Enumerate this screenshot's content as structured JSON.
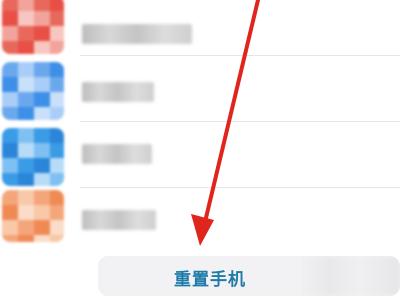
{
  "colors": {
    "accent_text": "#1e7aa8",
    "arrow": "#e0261c",
    "button_bg": "#f2f2f4",
    "separator": "#e6e6e6"
  },
  "list": {
    "items": [
      {
        "icon": "app-icon-red",
        "label": "",
        "icon_colors": [
          "#e8685c",
          "#f2a49c",
          "#e84f45",
          "#f7c6c0"
        ]
      },
      {
        "icon": "app-icon-blue",
        "label": "",
        "icon_colors": [
          "#6aa8ee",
          "#a9cdf6",
          "#3d8fe8",
          "#c9e0fa"
        ]
      },
      {
        "icon": "app-icon-cyan-blue",
        "label": "",
        "icon_colors": [
          "#3a9be6",
          "#7fc0f2",
          "#2a86d8",
          "#b8dcf7"
        ]
      },
      {
        "icon": "app-icon-orange",
        "label": "",
        "icon_colors": [
          "#f4a67a",
          "#f8c8a8",
          "#f08a55",
          "#fbdcc8"
        ]
      }
    ]
  },
  "bottom": {
    "reset_button_label": "重置手机"
  },
  "annotation": {
    "icon": "red-arrow-icon"
  }
}
